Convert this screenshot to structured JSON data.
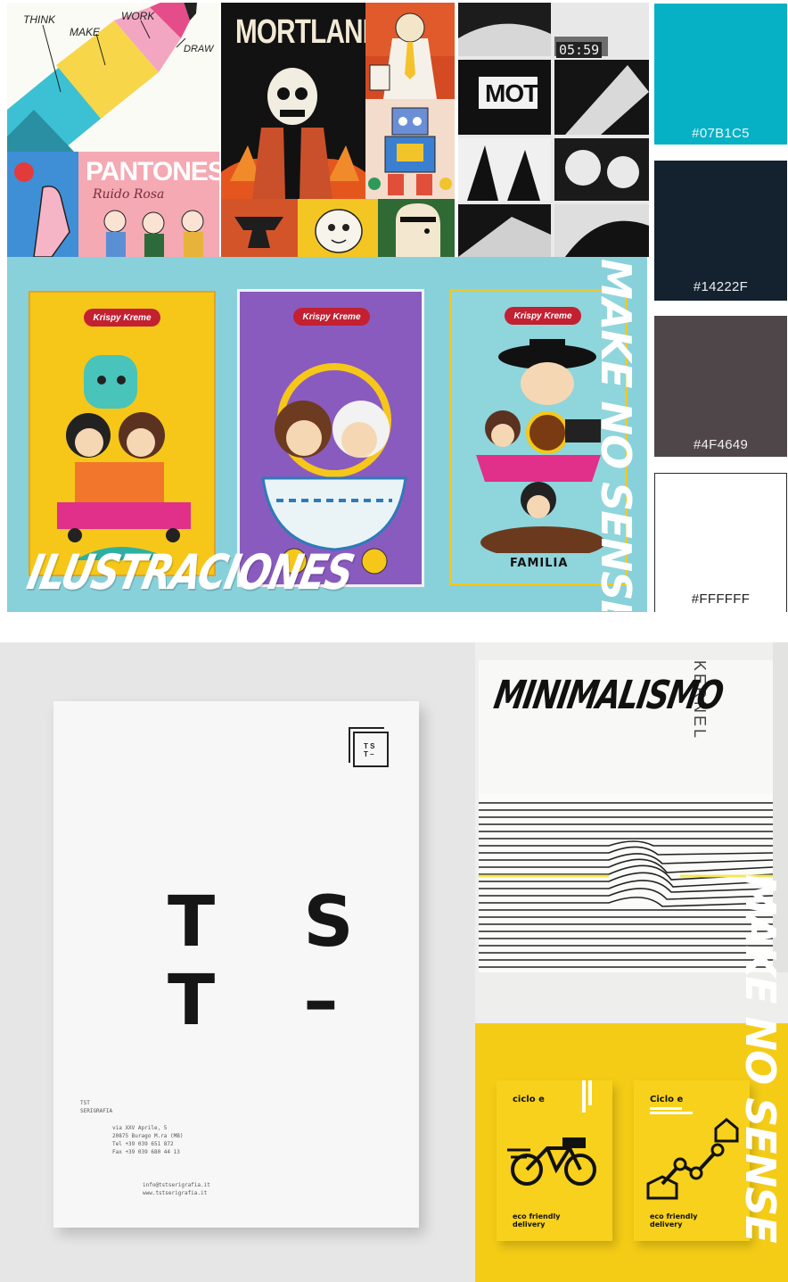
{
  "collage": {
    "think_words": [
      "THINK",
      "MAKE",
      "WORK",
      "DRAW"
    ],
    "pantones_title": "PANTONES",
    "pantones_script": "Ruido Rosa",
    "mortland_title": "MORTLAND",
    "clock_display": "05:59",
    "comic_sign": "MOT",
    "krispy_brand": "Krispy Kreme",
    "card_caption_right": "FAMILIA",
    "overlay_title": "ILUSTRACIONES",
    "side_brand": "MAKE NO SENSE"
  },
  "palette": [
    {
      "hex": "#07B1C5",
      "label": "#07B1C5",
      "text_color": "#e8f8fa"
    },
    {
      "hex": "#14222F",
      "label": "#14222F",
      "text_color": "#e9edf1"
    },
    {
      "hex": "#4F4649",
      "label": "#4F4649",
      "text_color": "#f1eeef"
    },
    {
      "hex": "#FFFFFF",
      "label": "#FFFFFF",
      "text_color": "#222222"
    }
  ],
  "minimal": {
    "title": "MINIMALISMO",
    "side_brand": "MAKE NO SENSE",
    "box_vertical_text": "KERNEL",
    "tst": {
      "logo": [
        "T S",
        "T –"
      ],
      "mark_line1": "T S",
      "mark_line2": "T –",
      "studio_line1": "TST",
      "studio_line2": "SERIGRAFIA",
      "address": [
        "via XXV Aprile, 5",
        "20875 Burago M.ra (MB)",
        "Tel +39 039 651 872",
        "Fax +39 039 680 44 13"
      ],
      "contact": [
        "info@tstserigrafia.it",
        "www.tstserigrafia.it"
      ]
    },
    "ciclo": {
      "brand": "ciclo e",
      "brand_right": "Ciclo e",
      "tagline": "eco friendly",
      "tagline2": "delivery"
    }
  }
}
